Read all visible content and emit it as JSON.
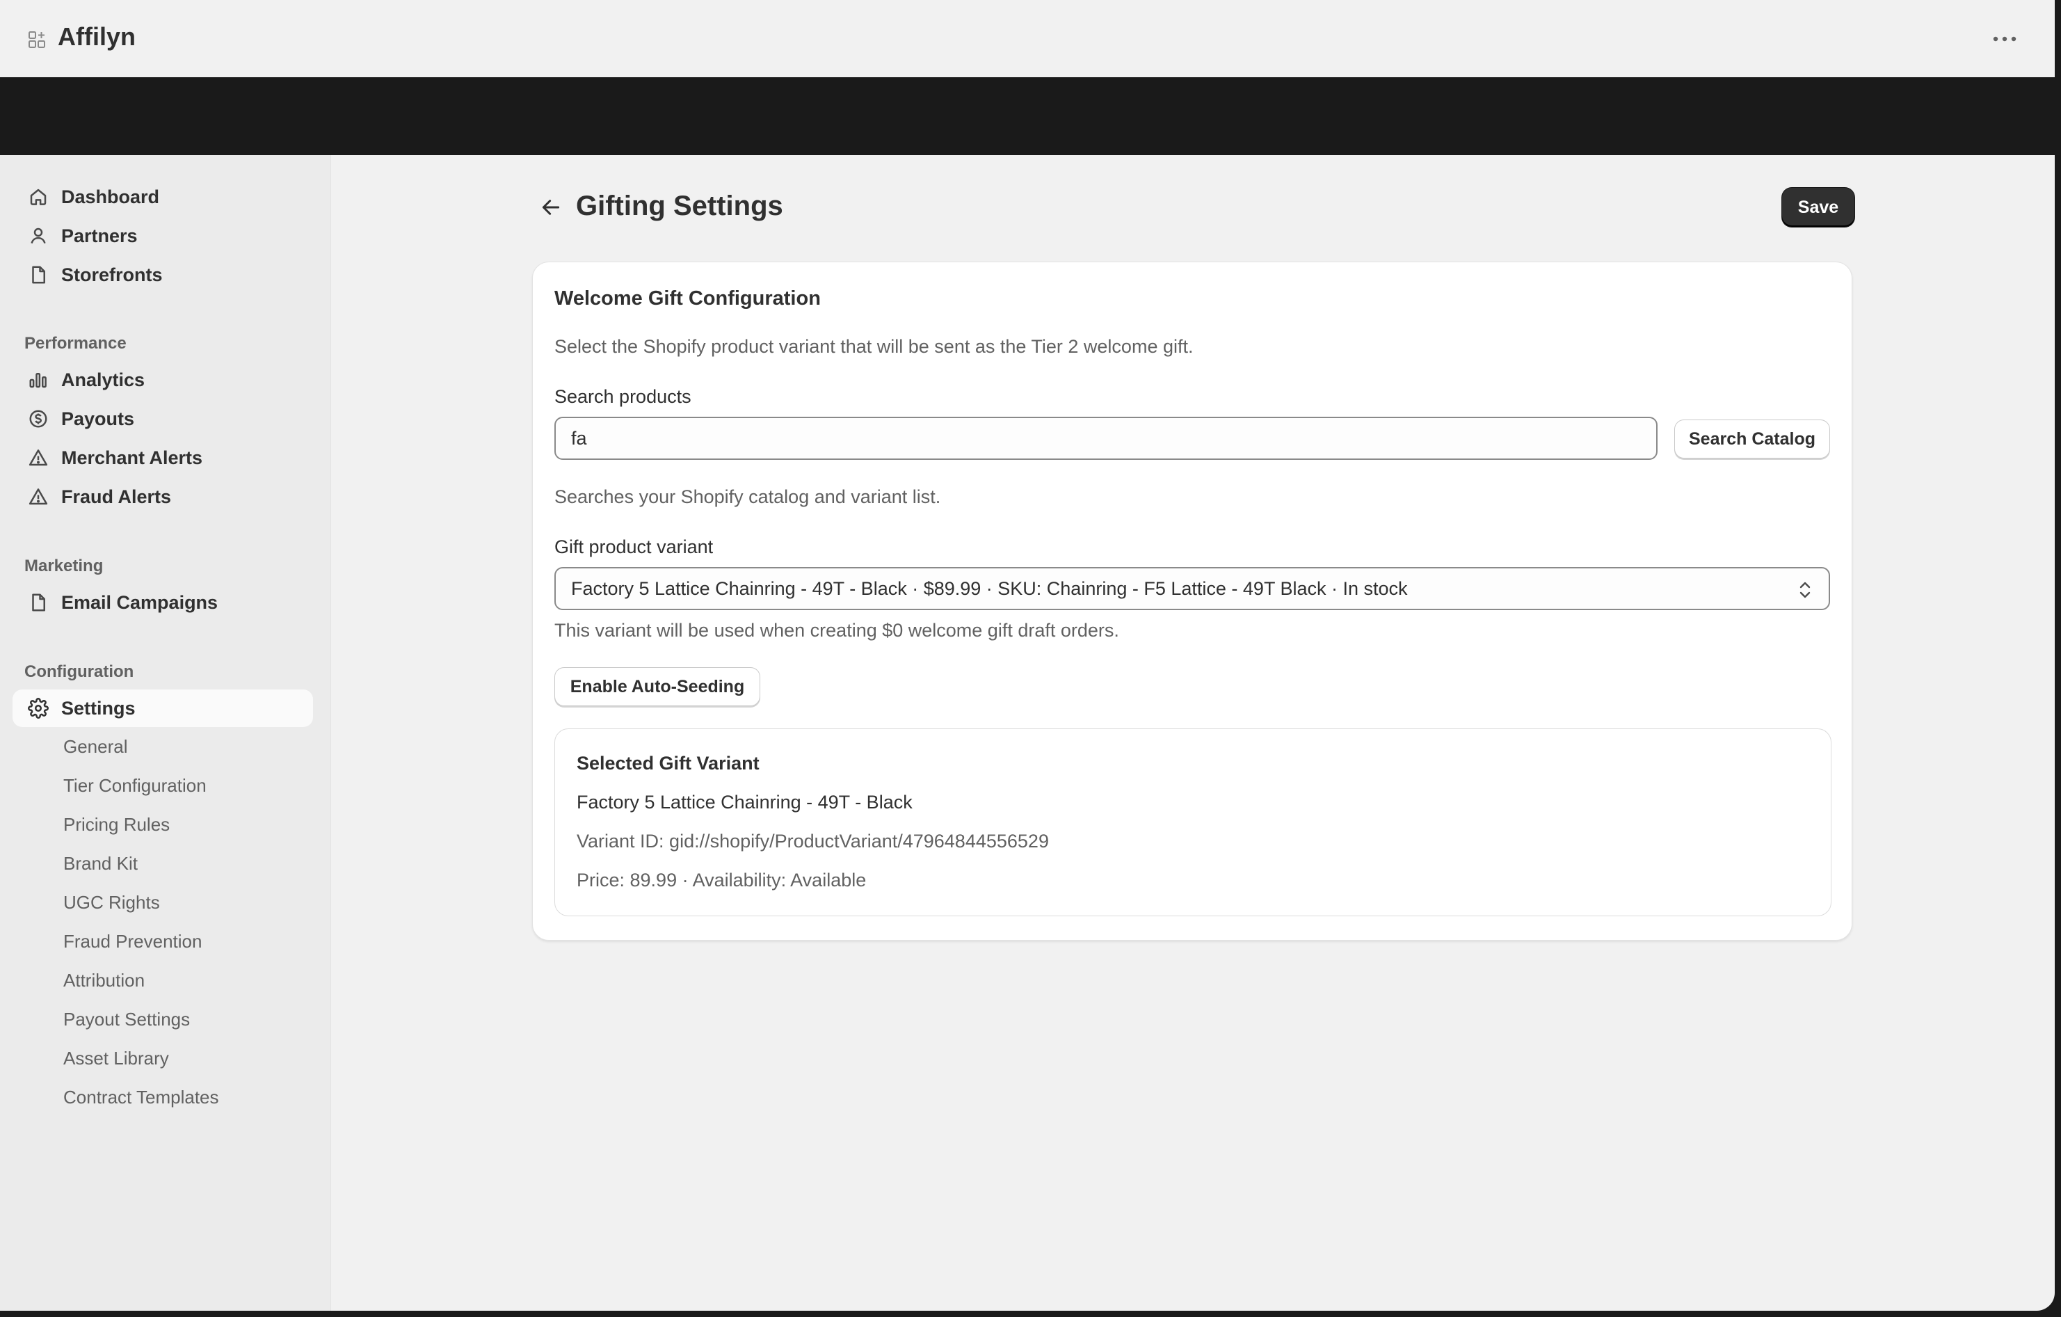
{
  "app": {
    "title": "Affilyn"
  },
  "sidebar": {
    "main": [
      {
        "label": "Dashboard",
        "icon": "home-icon"
      },
      {
        "label": "Partners",
        "icon": "person-icon"
      },
      {
        "label": "Storefronts",
        "icon": "file-icon"
      }
    ],
    "performance_label": "Performance",
    "performance": [
      {
        "label": "Analytics",
        "icon": "bar-chart-icon"
      },
      {
        "label": "Payouts",
        "icon": "dollar-circle-icon"
      },
      {
        "label": "Merchant Alerts",
        "icon": "alert-triangle-icon"
      },
      {
        "label": "Fraud Alerts",
        "icon": "alert-triangle-icon"
      }
    ],
    "marketing_label": "Marketing",
    "marketing": [
      {
        "label": "Email Campaigns",
        "icon": "file-icon"
      }
    ],
    "configuration_label": "Configuration",
    "settings": {
      "label": "Settings",
      "icon": "gear-icon"
    },
    "settings_sub": [
      "General",
      "Tier Configuration",
      "Pricing Rules",
      "Brand Kit",
      "UGC Rights",
      "Fraud Prevention",
      "Attribution",
      "Payout Settings",
      "Asset Library",
      "Contract Templates"
    ]
  },
  "page": {
    "title": "Gifting Settings",
    "save_label": "Save"
  },
  "card": {
    "title": "Welcome Gift Configuration",
    "description": "Select the Shopify product variant that will be sent as the Tier 2 welcome gift.",
    "search_label": "Search products",
    "search_value": "fa",
    "search_button": "Search Catalog",
    "search_help": "Searches your Shopify catalog and variant list.",
    "variant_label": "Gift product variant",
    "variant_selected": "Factory 5 Lattice Chainring - 49T - Black · $89.99 · SKU: Chainring - F5 Lattice - 49T Black · In stock",
    "variant_help": "This variant will be used when creating $0 welcome gift draft orders.",
    "auto_seed_button": "Enable Auto-Seeding",
    "selected": {
      "title": "Selected Gift Variant",
      "name": "Factory 5 Lattice Chainring - 49T - Black",
      "variant_id": "Variant ID: gid://shopify/ProductVariant/47964844556529",
      "price_availability": "Price: 89.99 · Availability: Available"
    }
  }
}
